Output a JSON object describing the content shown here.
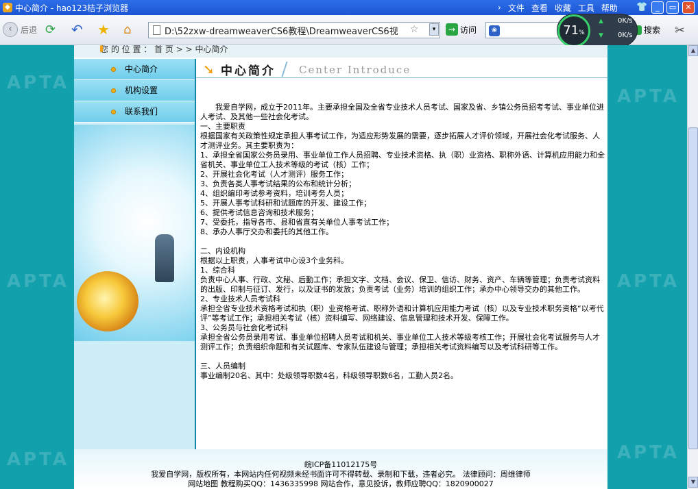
{
  "window": {
    "title": "中心简介 - hao123桔子浏览器",
    "menus": [
      "文件",
      "查看",
      "收藏",
      "工具",
      "帮助"
    ]
  },
  "toolbar": {
    "back_label": "后退",
    "address": "D:\\52zxw-dreamweaverCS6教程\\DreamweaverCS6视",
    "go_label": "访问",
    "search_label": "搜索",
    "speed_percent": "71",
    "speed_unit": "%",
    "upload_speed": "0K/s",
    "download_speed": "0K/s"
  },
  "breadcrumb": {
    "text": "您 的 位 置 ： 首 页 > > 中心简介"
  },
  "sidebar": {
    "items": [
      {
        "label": "中心简介"
      },
      {
        "label": "机构设置"
      },
      {
        "label": "联系我们"
      }
    ]
  },
  "main": {
    "heading_cn": "中心简介",
    "heading_en": "Center Introduce",
    "paragraphs": [
      "我爱自学网，成立于2011年。主要承担全国及全省专业技术人员考试、国家及省、乡镇公务员招考考试、事业单位进人考试、及其他一些社会化考试。",
      "一、主要职责",
      "根据国家有关政策性规定承担人事考试工作，为适应形势发展的需要，逐步拓展人才评价领域，开展社会化考试服务、人才测评业务。其主要职责为：",
      "1、承担全省国家公务员录用、事业单位工作人员招聘、专业技术资格、执（职）业资格、职称外语、计算机应用能力和全省机关、事业单位工人技术等级的考试（核）工作；",
      "2、开展社会化考试（人才测评）服务工作；",
      "3、负责各类人事考试结果的公布和统计分析；",
      "4、组织编印考试参考资料，培训考务人员；",
      "5、开展人事考试科研和试题库的开发、建设工作；",
      "6、提供考试信息咨询和技术服务；",
      "7、受委托，指导各市、县和省直有关单位人事考试工作；",
      "8、承办人事厅交办和委托的其他工作。",
      "",
      "二、内设机构",
      "根据以上职责，人事考试中心设3个业务科。",
      "1、综合科",
      "负责中心人事、行政、文秘、后勤工作；承担文字、文档、会议、保卫、信访、财务、资产、车辆等管理；负责考试资料的出版、印制与征订、发行，以及证书的发放；负责考试（业务）培训的组织工作；承办中心领导交办的其他工作。",
      "2、专业技术人员考试科",
      "承担全省专业技术资格考试和执（职）业资格考试、职称外语和计算机应用能力考试（核）以及专业技术职务资格“以考代评”等考试工作；承担相关考试（核）资料编写、网络建设、信息管理和技术开发、保障工作。",
      "3、公务员与社会化考试科",
      "承担全省公务员录用考试、事业单位招聘人员考试和机关、事业单位工人技术等级考核工作；开展社会化考试服务与人才测评工作；负责组织命题和有关试题库、专家队伍建设与管理；承担相关考试资料编写以及考试科研等工作。",
      "",
      "三、人员编制",
      "事业编制20名、其中：处级领导职数4名，科级领导职数6名，工勤人员2名。"
    ]
  },
  "footer": {
    "line1": "皖ICP备11012175号",
    "line2": "我爱自学网，版权所有，本网站内任何视频未经书面许可不得转载、录制和下载，违者必究。  法律顾问：周维律师",
    "line3": "网站地图 教程购买QQ：1436335998 网站合作，意见投诉，教师应聘QQ：1820900027"
  },
  "colors": {
    "page_bg": "#13a0ad",
    "title_bar": "#2d6ee8",
    "nav_bg": "#6fcdeb",
    "accent_orange": "#f39a00"
  }
}
